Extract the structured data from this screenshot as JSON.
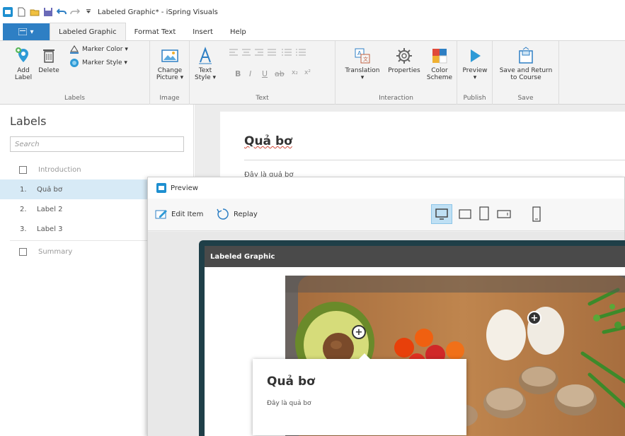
{
  "window": {
    "title": "Labeled Graphic* - iSpring Visuals"
  },
  "tabs": {
    "items": [
      {
        "label": "Labeled Graphic"
      },
      {
        "label": "Format Text"
      },
      {
        "label": "Insert"
      },
      {
        "label": "Help"
      }
    ]
  },
  "ribbon": {
    "add_label": "Add\nLabel",
    "delete": "Delete",
    "marker_color": "Marker Color ▾",
    "marker_style": "Marker Style ▾",
    "labels_group": "Labels",
    "change_picture": "Change\nPicture ▾",
    "image_group": "Image",
    "text_style": "Text\nStyle ▾",
    "text_group": "Text",
    "translation": "Translation\n▾",
    "properties": "Properties",
    "color_scheme": "Color\nScheme",
    "interaction_group": "Interaction",
    "preview": "Preview\n▾",
    "publish_group": "Publish",
    "save_return": "Save and Return\nto Course",
    "save_group": "Save"
  },
  "panel": {
    "title": "Labels",
    "search_placeholder": "Search",
    "intro": "Introduction",
    "items": [
      {
        "num": "1.",
        "label": "Quả bơ"
      },
      {
        "num": "2.",
        "label": "Label 2"
      },
      {
        "num": "3.",
        "label": "Label 3"
      }
    ],
    "summary": "Summary"
  },
  "slide": {
    "title": "Quả bơ",
    "desc": "Đây là quả bơ"
  },
  "preview": {
    "title": "Preview",
    "edit_item": "Edit Item",
    "replay": "Replay",
    "player_title": "Labeled Graphic",
    "popup_title": "Quả bơ",
    "popup_desc": "Đây là quả bơ"
  },
  "colors": {
    "accent": "#2e7fc4",
    "selected_row": "#d7eaf6",
    "player_frame": "#1f3f48"
  }
}
